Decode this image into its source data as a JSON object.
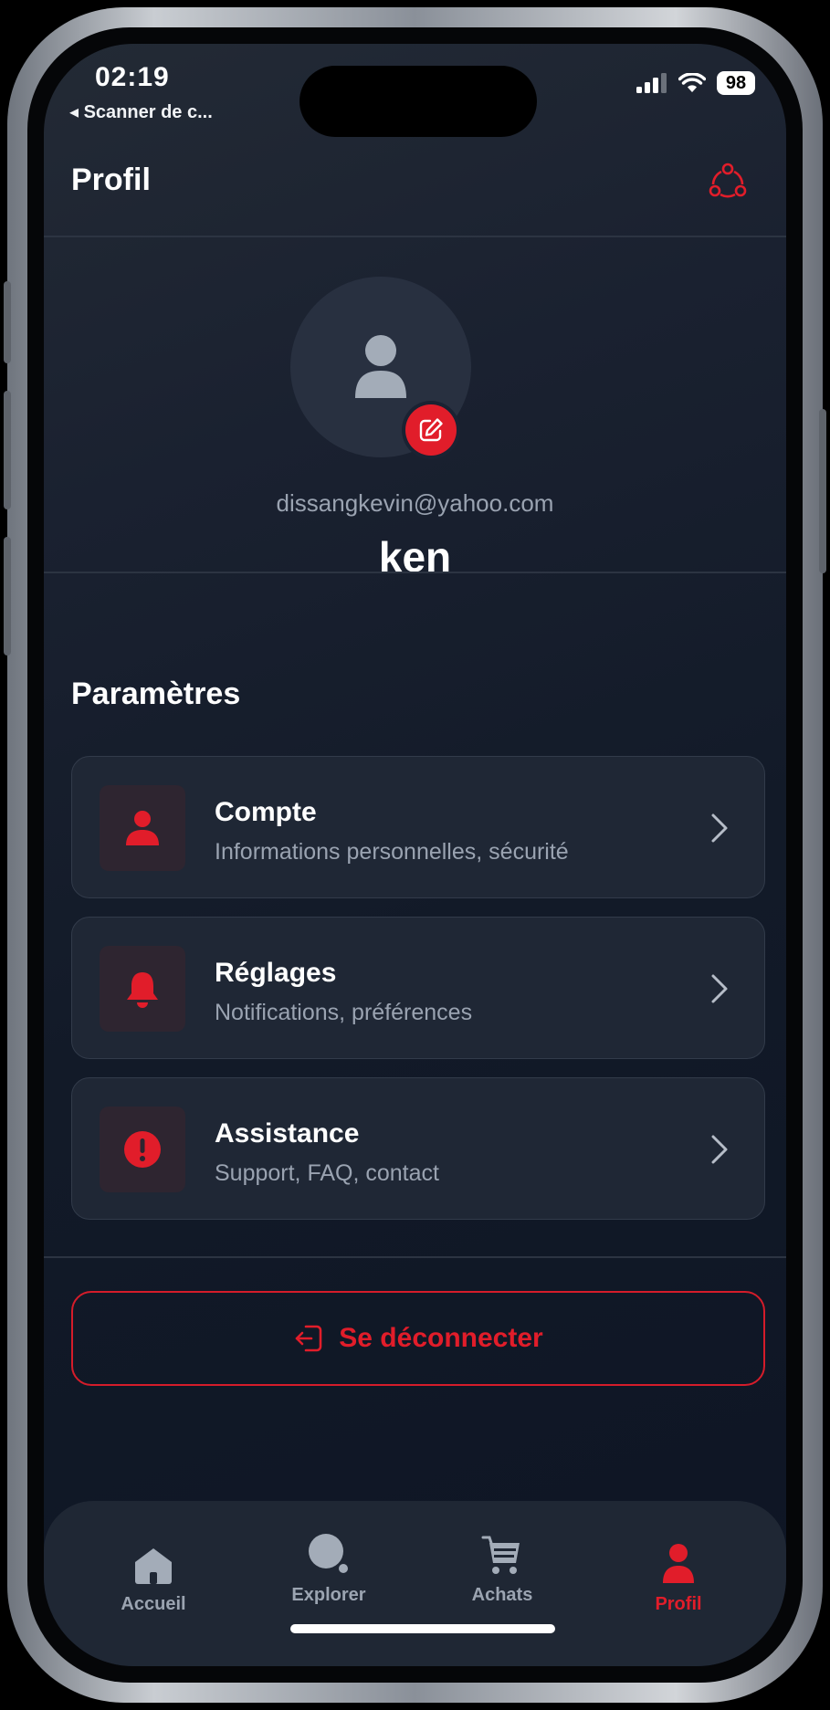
{
  "status_bar": {
    "time": "02:19",
    "back_app": "◂ Scanner de c...",
    "battery": "98"
  },
  "header": {
    "title": "Profil",
    "action_icon": "share-icon"
  },
  "profile": {
    "email": "dissangkevin@yahoo.com",
    "username": "ken"
  },
  "settings": {
    "title": "Paramètres",
    "items": [
      {
        "title": "Compte",
        "subtitle": "Informations personnelles, sécurité",
        "icon": "user-icon"
      },
      {
        "title": "Réglages",
        "subtitle": "Notifications, préférences",
        "icon": "bell-icon"
      },
      {
        "title": "Assistance",
        "subtitle": "Support, FAQ, contact",
        "icon": "alert-icon"
      }
    ]
  },
  "logout": {
    "label": "Se déconnecter"
  },
  "tabbar": {
    "items": [
      {
        "label": "Accueil",
        "icon": "home-icon",
        "active": false
      },
      {
        "label": "Explorer",
        "icon": "explore-icon",
        "active": false
      },
      {
        "label": "Achats",
        "icon": "cart-icon",
        "active": false
      },
      {
        "label": "Profil",
        "icon": "profile-icon",
        "active": true
      }
    ]
  },
  "colors": {
    "accent": "#e11d2a",
    "background": "#121a28",
    "card": "#1f2735",
    "muted_text": "#9aa3b1"
  }
}
